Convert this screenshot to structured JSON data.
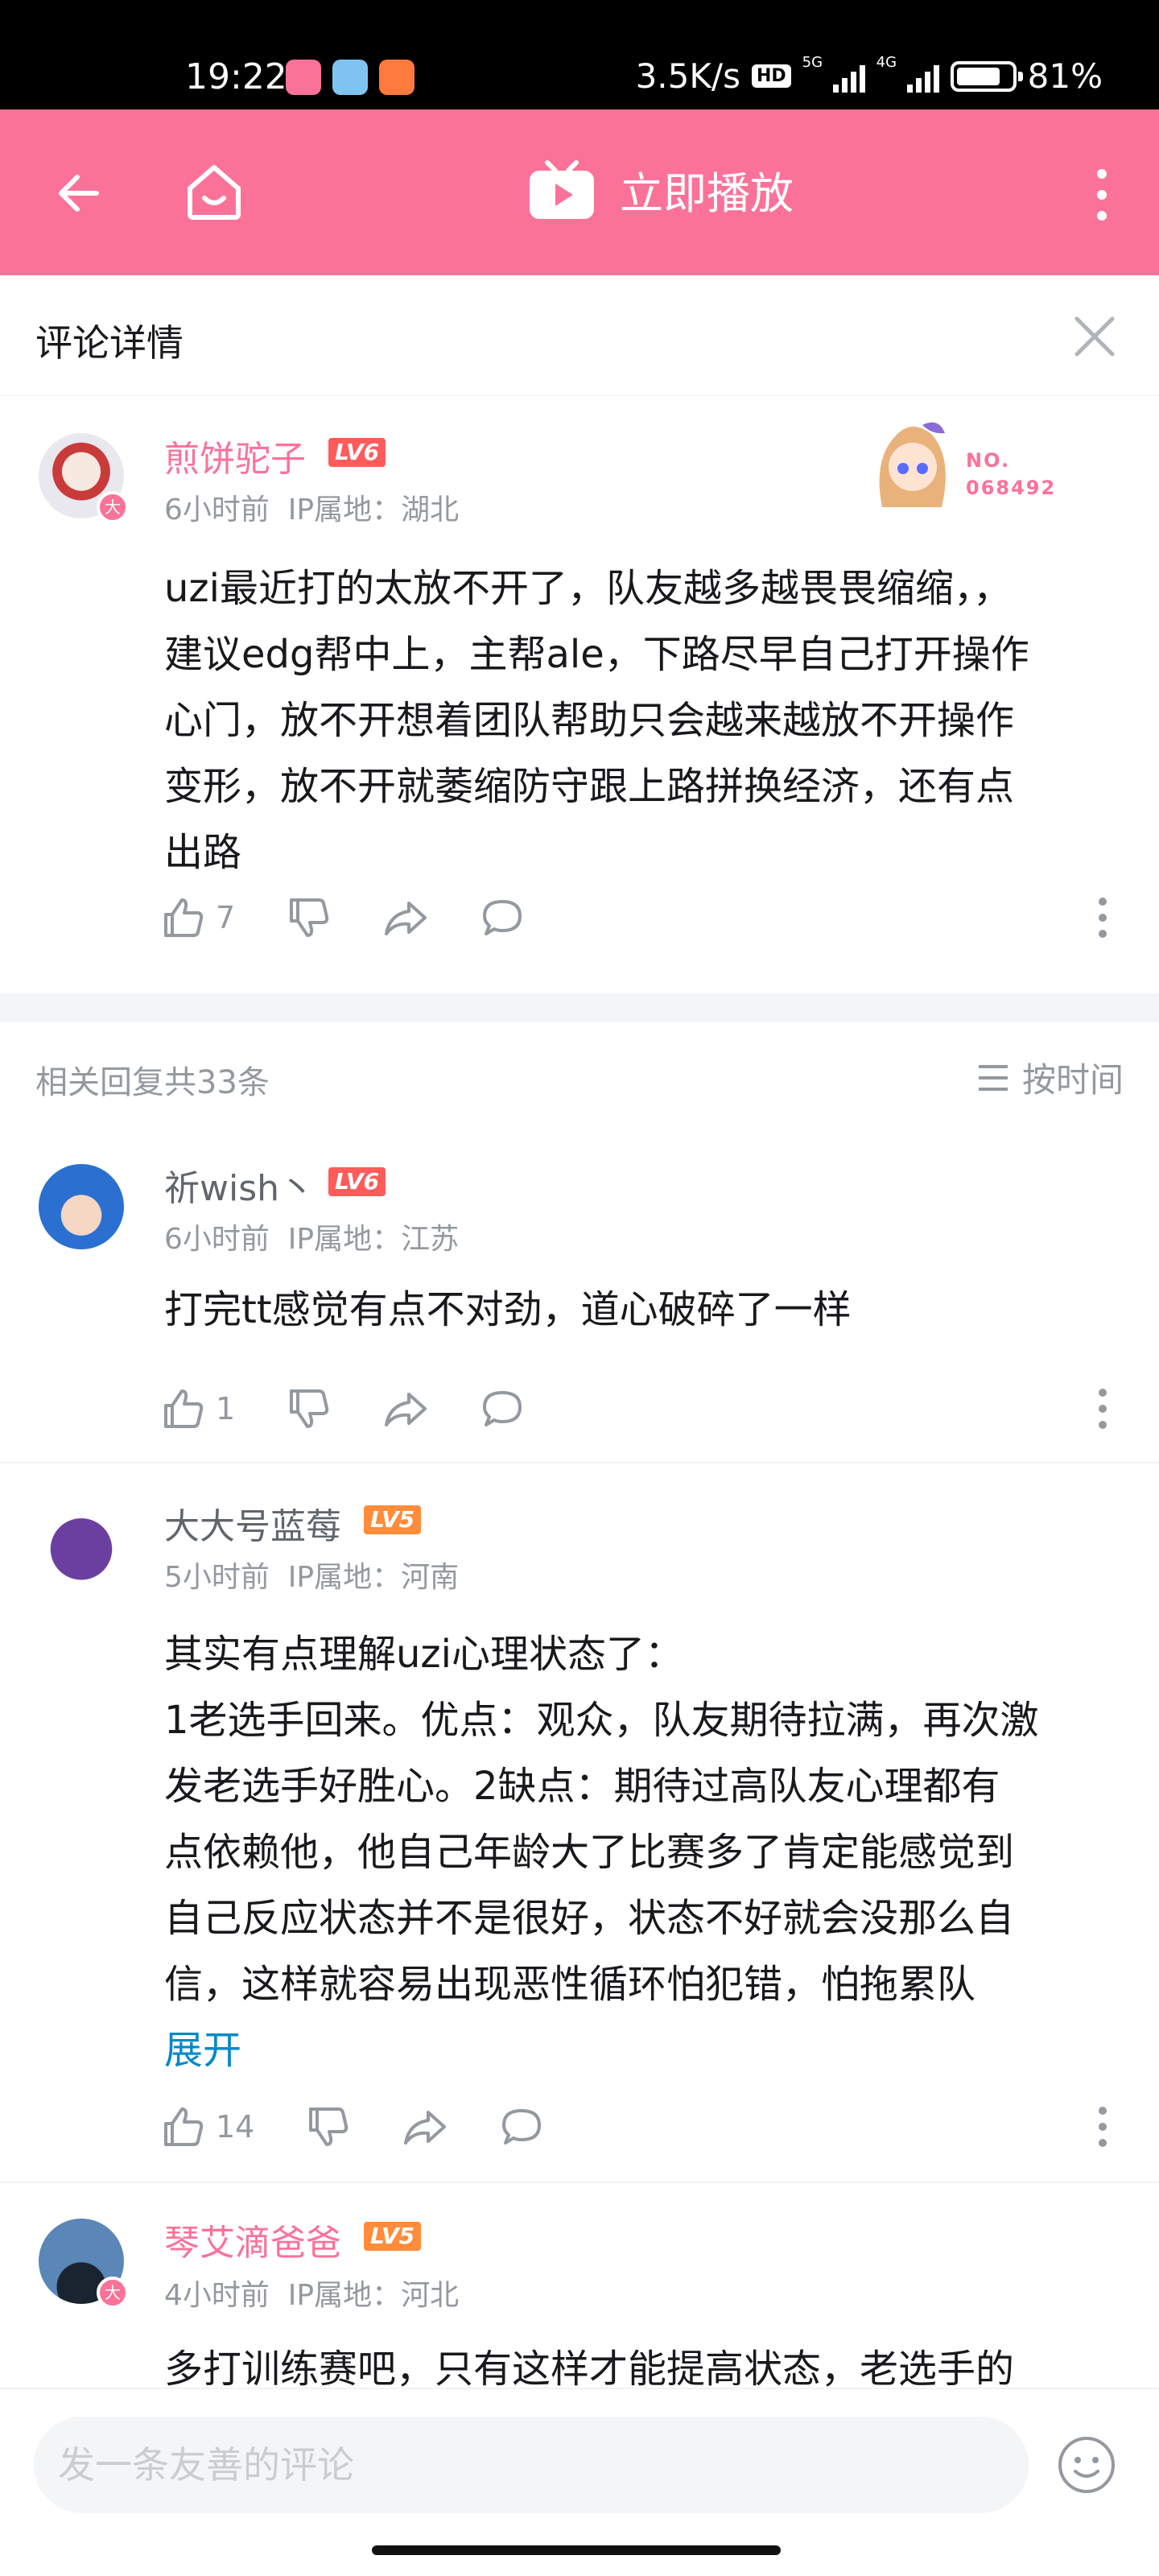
{
  "status_bar": {
    "time": "19:22",
    "speed": "3.5K/s",
    "hd": "HD",
    "net5g": "5G",
    "net4g": "4G",
    "battery": "81%"
  },
  "header": {
    "play_label": "立即播放"
  },
  "panel": {
    "title": "评论详情"
  },
  "main_comment": {
    "username": "煎饼驼子",
    "level": "LV6",
    "time": "6小时前",
    "ip": "IP属地：湖北",
    "fan_no": "NO.",
    "fan_number": "068492",
    "content": [
      "uzi最近打的太放不开了，队友越多越畏畏缩缩，，",
      "建议edg帮中上，主帮ale，下路尽早自己打开操作",
      "心门，放不开想着团队帮助只会越来越放不开操作",
      "变形，放不开就萎缩防守跟上路拼换经济，还有点",
      "出路"
    ],
    "likes": "7"
  },
  "replies_header": {
    "count": "相关回复共33条",
    "sort": "按时间"
  },
  "replies": [
    {
      "username": "祈wish丶",
      "level": "LV6",
      "time": "6小时前",
      "ip": "IP属地：江苏",
      "content": [
        "打完tt感觉有点不对劲，道心破碎了一样"
      ],
      "likes": "1"
    },
    {
      "username": "大大号蓝莓",
      "level": "LV5",
      "time": "5小时前",
      "ip": "IP属地：河南",
      "content": [
        "其实有点理解uzi心理状态了：",
        "1老选手回来。优点：观众，队友期待拉满，再次激",
        "发老选手好胜心。2缺点：期待过高队友心理都有",
        "点依赖他，他自己年龄大了比赛多了肯定能感觉到",
        "自己反应状态并不是很好，状态不好就会没那么自",
        "信，这样就容易出现恶性循环怕犯错，怕拖累队"
      ],
      "expand": "展开",
      "likes": "14"
    },
    {
      "username": "琴艾滴爸爸",
      "level": "LV5",
      "time": "4小时前",
      "ip": "IP属地：河北",
      "content": [
        "多打训练赛吧，只有这样才能提高状态，老选手的"
      ]
    }
  ],
  "bottom_bar": {
    "placeholder": "发一条友善的评论"
  },
  "colors": {
    "brand_pink": "#fb7299",
    "link_blue": "#008ac5",
    "lv6": "#ff5b5b",
    "lv5": "#ff8c3a"
  },
  "icons": [
    "back-arrow-icon",
    "home-icon",
    "tv-play-icon",
    "more-vertical-icon",
    "close-icon",
    "thumb-up-icon",
    "thumb-down-icon",
    "share-icon",
    "comment-icon",
    "sort-list-icon",
    "emoji-icon"
  ]
}
